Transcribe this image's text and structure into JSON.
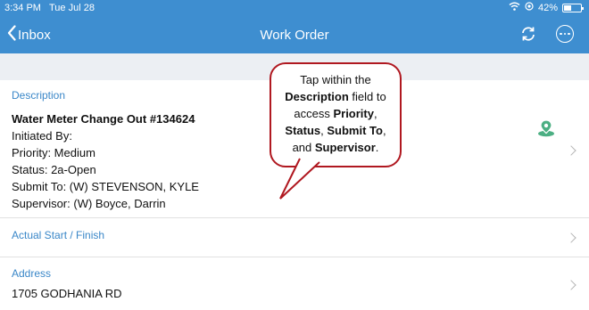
{
  "status_bar": {
    "time": "3:34 PM",
    "date": "Tue Jul 28",
    "battery": "42%",
    "battery_level": 0.42
  },
  "nav": {
    "back_label": "Inbox",
    "title": "Work Order"
  },
  "description": {
    "label": "Description",
    "title": "Water Meter Change Out #134624",
    "initiated_by": "Initiated By:",
    "priority": "Priority: Medium",
    "status": "Status: 2a-Open",
    "submit_to": "Submit To: (W) STEVENSON, KYLE",
    "supervisor": "Supervisor: (W) Boyce, Darrin"
  },
  "actual_start_finish": {
    "label": "Actual Start / Finish"
  },
  "address": {
    "label": "Address",
    "value": "1705 GODHANIA RD"
  },
  "callout": {
    "t1": "Tap within the",
    "b1": "Description",
    "t2": " field to",
    "t3": "access ",
    "b2": "Priority",
    "t4": ",",
    "b3": "Status",
    "t5": ", ",
    "b4": "Submit To",
    "t6": ",",
    "t7": "and ",
    "b5": "Supervisor",
    "t8": "."
  },
  "colors": {
    "header": "#3e8ed0",
    "label": "#3a87c8",
    "callout_border": "#b01820",
    "map_pin": "#4caf83"
  },
  "icons": [
    "wifi-icon",
    "location-icon",
    "battery-icon",
    "chevron-left-icon",
    "refresh-icon",
    "more-icon",
    "map-pin-icon",
    "chevron-right-icon"
  ]
}
